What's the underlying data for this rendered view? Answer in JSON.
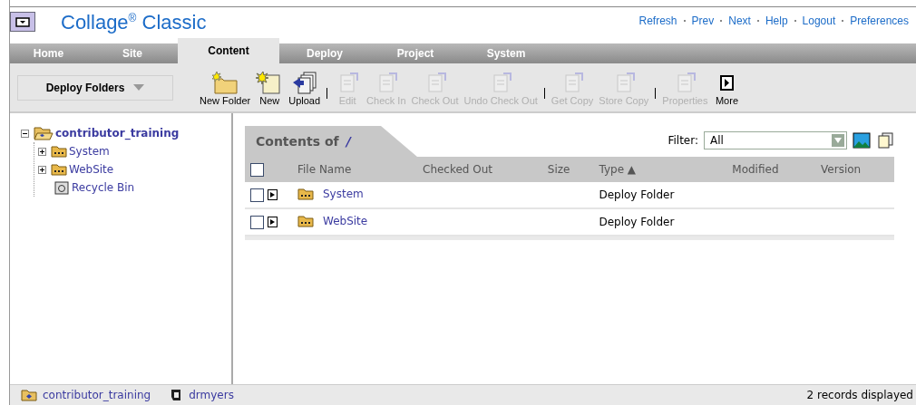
{
  "app": {
    "title": "Collage$^{®}$ Classic"
  },
  "top_links": [
    "Refresh",
    "Prev",
    "Next",
    "Help",
    "Logout",
    "Preferences"
  ],
  "tabs": [
    {
      "label": "Home",
      "selected": false
    },
    {
      "label": "Site",
      "selected": false
    },
    {
      "label": "Content",
      "selected": true
    },
    {
      "label": "Deploy",
      "selected": false
    },
    {
      "label": "Project",
      "selected": false
    },
    {
      "label": "System",
      "selected": false
    }
  ],
  "view_selector": {
    "value": "Deploy Folders"
  },
  "toolbar": [
    {
      "kind": "button",
      "label": "New Folder",
      "disabled": false
    },
    {
      "kind": "button",
      "label": "New",
      "disabled": false
    },
    {
      "kind": "button",
      "label": "Upload",
      "disabled": false
    },
    {
      "kind": "separator"
    },
    {
      "kind": "button",
      "label": "Edit",
      "disabled": true
    },
    {
      "kind": "button",
      "label": "Check In",
      "disabled": true
    },
    {
      "kind": "button",
      "label": "Check Out",
      "disabled": true
    },
    {
      "kind": "button",
      "label": "Undo Check Out",
      "disabled": true
    },
    {
      "kind": "separator"
    },
    {
      "kind": "button",
      "label": "Get Copy",
      "disabled": true
    },
    {
      "kind": "button",
      "label": "Store Copy",
      "disabled": true
    },
    {
      "kind": "separator"
    },
    {
      "kind": "button",
      "label": "Properties",
      "disabled": true
    },
    {
      "kind": "button",
      "label": "More",
      "disabled": false
    }
  ],
  "tree": [
    {
      "label": "contributor_training",
      "kind": "root",
      "selected": true,
      "expanded": true,
      "children": [
        {
          "label": "System",
          "kind": "folder",
          "selected": false,
          "expanded": false
        },
        {
          "label": "WebSite",
          "kind": "folder",
          "selected": false,
          "expanded": false
        },
        {
          "label": "Recycle Bin",
          "kind": "bin",
          "selected": false
        }
      ]
    }
  ],
  "contents": {
    "title": "Contents of",
    "path": "/",
    "filter_label": "Filter:",
    "filter_value": "All",
    "select_all": {
      "checked": false
    },
    "columns": [
      "File Name",
      "Checked Out",
      "Size",
      "Type ▲",
      "Modified",
      "Version"
    ],
    "rows": [
      {
        "checked": false,
        "name": "System",
        "type": "Deploy Folder"
      },
      {
        "checked": false,
        "name": "WebSite",
        "type": "Deploy Folder"
      }
    ]
  },
  "status_bar": {
    "site": "contributor_training",
    "user": "drmyers",
    "records": "2 records displayed"
  }
}
